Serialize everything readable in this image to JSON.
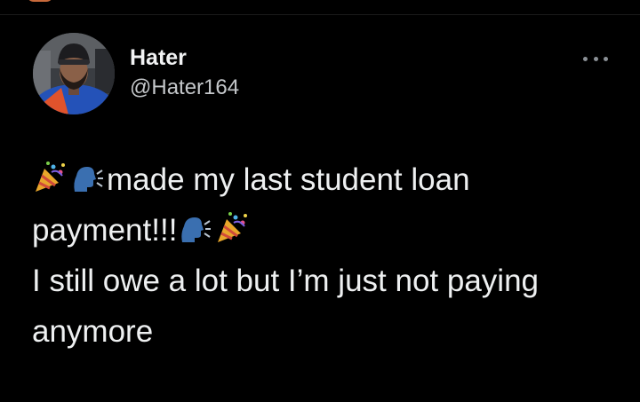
{
  "tweet": {
    "author": {
      "display_name": "Hater",
      "handle": "@Hater164"
    },
    "lines": {
      "line1": "made my last student loan",
      "line2": "payment!!!",
      "line3": "I still owe a lot but I’m just not paying",
      "line4": "anymore"
    },
    "emojis": [
      "party-popper-icon",
      "speaking-head-icon"
    ]
  },
  "colors": {
    "background": "#000000",
    "text": "#eef0f1",
    "secondary_text": "#c4c7ca"
  }
}
